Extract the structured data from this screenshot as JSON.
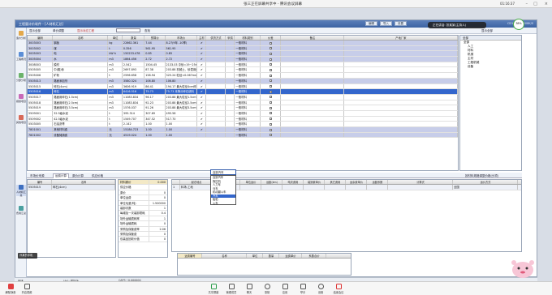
{
  "meeting": {
    "title": "张三正在屏幕共享中 - 腾讯会议屏幕",
    "clock": "01:16:37",
    "speaking": "正在讲话: 张某某(主持人)",
    "network": "38%",
    "cam_label": "孙某的手机",
    "toolbar": [
      "解除静音",
      "开启视频",
      "共享屏幕",
      "管理成员",
      "聊天",
      "录制",
      "应用",
      "举手",
      "设置",
      "结束会议"
    ]
  },
  "app": {
    "title": "工程量计价软件 - [人材机汇总]",
    "title_buttons": [
      "编辑",
      "导入",
      "设置"
    ],
    "title_right": "CD1234 | 1008K/S",
    "nav": [
      "造价分析",
      "工程概况",
      "分部分项",
      "措施项目",
      "其他项目",
      "人材机汇总",
      "费用汇总"
    ],
    "toolbar": [
      "显示全部",
      "单价调整",
      "显示对应工程"
    ],
    "search_btn": "查找",
    "right_toolbar": "显示全部"
  },
  "grid": {
    "headers": [
      "编码",
      "名称",
      "单位",
      "数量",
      "预算价",
      "市场价",
      "主材",
      "供货方式",
      "甲供",
      "材料类别",
      "价差",
      "备注",
      "产地厂家"
    ],
    "rows": [
      {
        "code": "3003003",
        "name": "钢板",
        "unit": "kg",
        "qty": "22662.361",
        "p1": "7.44",
        "p2": "8.27(9年 -10季)",
        "c1": "✔",
        "mat": "一般材料",
        "style": "alt"
      },
      {
        "code": "3003002",
        "name": "煤",
        "unit": "t",
        "qty": "0.356",
        "p1": "561.95",
        "p2": "561.95",
        "c1": "✔",
        "mat": "一般材料",
        "style": "alt"
      },
      {
        "code": "3005003",
        "name": "电",
        "unit": "kW·h",
        "qty": "150233.478",
        "p1": "0.85",
        "p2": "0.85",
        "c1": "✔",
        "mat": "一般材料",
        "style": "alt"
      },
      {
        "code": "3005004",
        "name": "水",
        "unit": "m3",
        "qty": "1864.456",
        "p1": "2.72",
        "p2": "2.72",
        "c1": "✔",
        "mat": "一般材料",
        "style": "alt"
      },
      {
        "code": "3008003",
        "name": "模材",
        "unit": "m3",
        "qty": "2.542",
        "p1": "1504.45",
        "p2": "2133.03 中砂=19~25mm",
        "c1": "✔",
        "mat": "一般材料",
        "style": ""
      },
      {
        "code": "5505005",
        "name": "中(粗)砂",
        "unit": "m3",
        "qty": "2697.893",
        "p1": "87.38",
        "p2": "203.88 机械土、砂混用修",
        "c1": "✔",
        "mat": "一般材料",
        "style": ""
      },
      {
        "code": "5505006",
        "name": "矿粉",
        "unit": "t",
        "qty": "2596.658",
        "p1": "158.94",
        "p2": "325.24 粒径<0.067mm",
        "c1": "✔",
        "mat": "一般材料",
        "style": ""
      },
      {
        "code": "5505013",
        "name": "路面添加剂",
        "unit": "m3",
        "qty": "3580.324",
        "p1": "106.80",
        "p2": "106.80",
        "c1": "✔",
        "mat": "一般材料",
        "style": "alt"
      },
      {
        "code": "5505015",
        "name": "碎石(4cm)",
        "unit": "m3",
        "qty": "3606.919",
        "p1": "86.41",
        "p2": "194.17 最大粒径4cm碎石",
        "c1": "✔",
        "mat": "一般材料",
        "style": ""
      },
      {
        "code": "5505016",
        "name": "碎石",
        "unit": "m3",
        "qty": "6416.516",
        "p1": "75.73",
        "p2": "75.73 未筛分碎石统料",
        "c1": "✔",
        "mat": "一般材料",
        "style": "sel"
      },
      {
        "code": "5505017",
        "name": "路面用碎石(1.5cm)",
        "unit": "m3",
        "qty": "11083.834",
        "p1": "96.17",
        "p2": "203.88 最大粒径1.5cm碎",
        "c1": "✔",
        "mat": "一般材料",
        "style": ""
      },
      {
        "code": "5505018",
        "name": "路面用碎石(2.5cm)",
        "unit": "m3",
        "qty": "11083.834",
        "p1": "92.23",
        "p2": "203.88 最大粒径2.5cm碎",
        "c1": "✔",
        "mat": "一般材料",
        "style": ""
      },
      {
        "code": "5505019",
        "name": "路面用碎石(3.5cm)",
        "unit": "m3",
        "qty": "1576.037",
        "p1": "91.26",
        "p2": "203.88 最大粒径3.5cm碎",
        "c1": "✔",
        "mat": "一般材料",
        "style": ""
      },
      {
        "code": "5509001",
        "name": "32.5级水泥",
        "unit": "t",
        "qty": "395.314",
        "p1": "307.69",
        "p2": "495.58",
        "c1": "✔",
        "mat": "一般材料",
        "style": ""
      },
      {
        "code": "5509002",
        "name": "42.5级水泥",
        "unit": "t",
        "qty": "1549.707",
        "p1": "347.52",
        "p2": "517.70",
        "c1": "✔",
        "mat": "一般材料",
        "style": ""
      },
      {
        "code": "5503005",
        "name": "石油沥青",
        "unit": "t",
        "qty": "2.142",
        "p1": "1.00",
        "p2": "1.00",
        "c1": "✔",
        "mat": "一般材料",
        "style": ""
      },
      {
        "code": "7801001",
        "name": "其他材料费",
        "unit": "元",
        "qty": "15184.723",
        "p1": "1.00",
        "p2": "1.00",
        "c1": "✔",
        "mat": "一般材料",
        "style": "alt"
      },
      {
        "code": "7801002",
        "name": "设备摊销费",
        "unit": "元",
        "qty": "4519.024",
        "p1": "1.00",
        "p2": "1.00",
        "c1": "",
        "mat": "一般材料",
        "style": "alt"
      }
    ]
  },
  "tree": {
    "header": "全部",
    "nodes": [
      {
        "label": "全部",
        "sub": false
      },
      {
        "label": "人工",
        "sub": true
      },
      {
        "label": "材料",
        "sub": true
      },
      {
        "label": "机械",
        "sub": true
      },
      {
        "label": "主材",
        "sub": true
      },
      {
        "label": "工程机械",
        "sub": true
      },
      {
        "label": "设备",
        "sub": true
      }
    ]
  },
  "tabs": [
    "市场价来源",
    "运费计算",
    "原价计算",
    "供应价格"
  ],
  "tabs_right": "按材料规格调整价格(分项)",
  "bottom_left": {
    "headers": [
      "编号",
      "名称"
    ],
    "rows": [
      {
        "code": "5505015",
        "name": "碎石(4cm)"
      }
    ]
  },
  "props": [
    {
      "k": "材料原价",
      "v": "0.000",
      "hd": true
    },
    {
      "k": "供应价格",
      "v": ""
    },
    {
      "k": "原价",
      "v": "0"
    },
    {
      "k": "单位运费",
      "v": "0"
    },
    {
      "k": "单位毛重(吨)",
      "v": "1.500000"
    },
    {
      "k": "装卸次数",
      "v": "1"
    },
    {
      "k": "每增加一次装卸损耗",
      "v": "0.4"
    },
    {
      "k": "场外运输损耗率",
      "v": "1"
    },
    {
      "k": "场外运输损耗",
      "v": "0"
    },
    {
      "k": "采购及保管费率",
      "v": "2.06"
    },
    {
      "k": "采购及保管费",
      "v": "0"
    },
    {
      "k": "包装品回收价值",
      "v": "0"
    }
  ],
  "br": {
    "headers": [
      "起讫地点",
      "运输工具",
      "单位运价",
      "运距(km)",
      "吨次费用",
      "装卸费单价",
      "其它费用",
      "运杂费单价",
      "运距系数",
      "计算式",
      "运价方式"
    ],
    "row": {
      "from": "料场-工地",
      "tool": "自卸汽车",
      "mode": "全国"
    },
    "dropdown_options": [
      "自卸汽车",
      "拖拉机",
      "人力车",
      "马车",
      "机动翻斗车",
      "汽车",
      "船舶",
      "火车"
    ],
    "dropdown_selected": 5
  },
  "br2": {
    "headers": [
      "运费编号",
      "名称",
      "单位",
      "数量",
      "运费单价",
      "系数合价"
    ]
  },
  "status": [
    "就绪",
    "计价: 模拟版",
    "CAP3 | 0.000000"
  ]
}
